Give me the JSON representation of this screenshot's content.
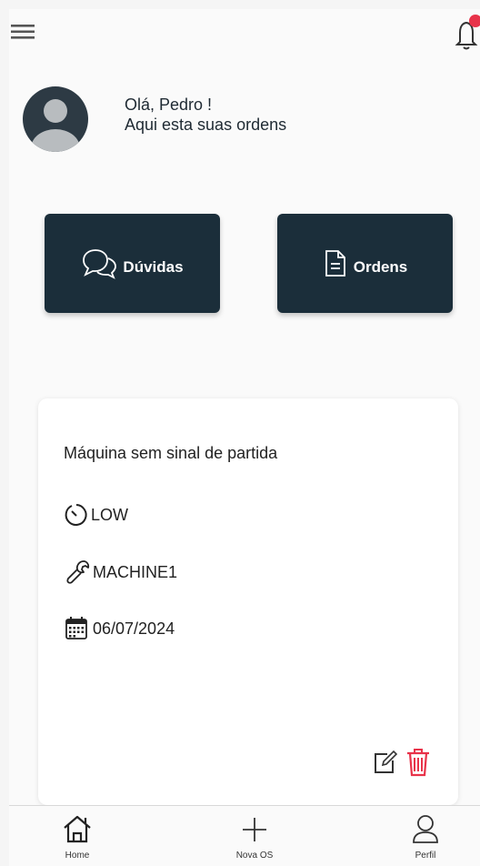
{
  "header": {
    "menu_icon": "hamburger-menu-icon",
    "notification_icon": "bell-icon",
    "badge_color": "#e8334a"
  },
  "greeting": {
    "line1": "Olá, Pedro !",
    "line2": "Aqui esta suas ordens"
  },
  "actions": [
    {
      "label": "Dúvidas",
      "icon": "chat-bubbles-icon"
    },
    {
      "label": "Ordens",
      "icon": "document-icon"
    }
  ],
  "order": {
    "title": "Máquina sem sinal de partida",
    "priority": "LOW",
    "machine": "MACHINE1",
    "date": "06/07/2024",
    "edit_icon": "edit-icon",
    "delete_icon": "trash-icon"
  },
  "bottom_nav": {
    "home": "Home",
    "new": "Nova OS",
    "profile": "Perfil"
  },
  "colors": {
    "primary": "#1b2e3a",
    "danger": "#e8334a"
  }
}
